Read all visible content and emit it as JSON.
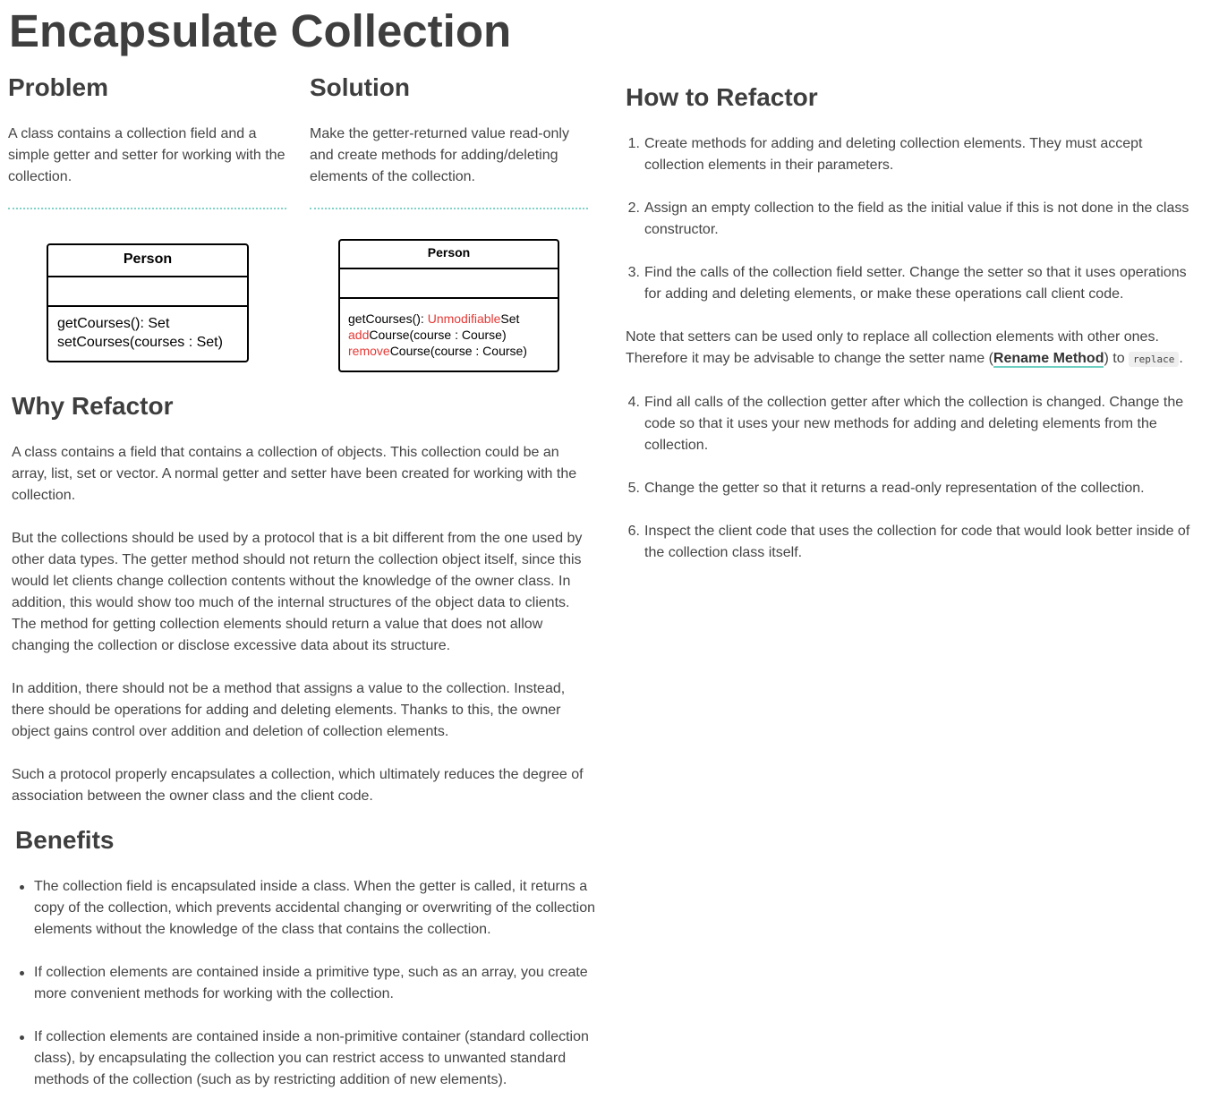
{
  "title": "Encapsulate Collection",
  "problem": {
    "heading": "Problem",
    "text": "A class contains a collection field and a simple getter and setter for working with the collection."
  },
  "solution": {
    "heading": "Solution",
    "text": "Make the getter-returned value read-only and create methods for adding/deleting elements of the collection."
  },
  "diagram_before": {
    "class_name": "Person",
    "methods": [
      "getCourses(): Set",
      "setCourses(courses : Set)"
    ]
  },
  "diagram_after": {
    "class_name": "Person",
    "m1_a": "getCourses(): ",
    "m1_b": "Unmodifiable",
    "m1_c": "Set",
    "m2_a": "add",
    "m2_b": "Course(course : Course)",
    "m3_a": "remove",
    "m3_b": "Course(course : Course)"
  },
  "why": {
    "heading": "Why Refactor",
    "paragraphs": [
      "A class contains a field that contains a collection of objects. This collection could be an array, list, set or vector. A normal getter and setter have been created for working with the collection.",
      "But the collections should be used by a protocol that is a bit different from the one used by other data types. The getter method should not return the collection object itself, since this would let clients change collection contents without the knowledge of the owner class. In addition, this would show too much of the internal structures of the object data to clients. The method for getting collection elements should return a value that does not allow changing the collection or disclose excessive data about its structure.",
      "In addition, there should not be a method that assigns a value to the collection. Instead, there should be operations for adding and deleting elements. Thanks to this, the owner object gains control over addition and deletion of collection elements.",
      "Such a protocol properly encapsulates a collection, which ultimately reduces the degree of association between the owner class and the client code."
    ]
  },
  "benefits": {
    "heading": "Benefits",
    "items": [
      "The collection field is encapsulated inside a class. When the getter is called, it returns a copy of the collection, which prevents accidental changing or overwriting of the collection elements without the knowledge of the class that contains the collection.",
      "If collection elements are contained inside a primitive type, such as an array, you create more convenient methods for working with the collection.",
      "If collection elements are contained inside a non-primitive container (standard collection class), by encapsulating the collection you can restrict access to unwanted standard methods of the collection (such as by restricting addition of new elements)."
    ]
  },
  "how": {
    "heading": "How to Refactor",
    "steps": [
      {
        "num": "1.",
        "text": "Create methods for adding and deleting collection elements. They must accept collection elements in their parameters."
      },
      {
        "num": "2.",
        "text": "Assign an empty collection to the field as the initial value if this is not done in the class constructor."
      },
      {
        "num": "3.",
        "text": "Find the calls of the collection field setter. Change the setter so that it uses operations for adding and deleting elements, or make these operations call client code."
      },
      {
        "num": "4.",
        "text": "Find all calls of the collection getter after which the collection is changed. Change the code so that it uses your new methods for adding and deleting elements from the collection."
      },
      {
        "num": "5.",
        "text": "Change the getter so that it returns a read-only representation of the collection."
      },
      {
        "num": "6.",
        "text": "Inspect the client code that uses the collection for code that would look better inside of the collection class itself."
      }
    ],
    "note_before": "Note that setters can be used only to replace all collection elements with other ones. Therefore it may be advisable to change the setter name (",
    "note_link": "Rename Method",
    "note_middle": ") to ",
    "note_code": "replace",
    "note_after": "."
  }
}
